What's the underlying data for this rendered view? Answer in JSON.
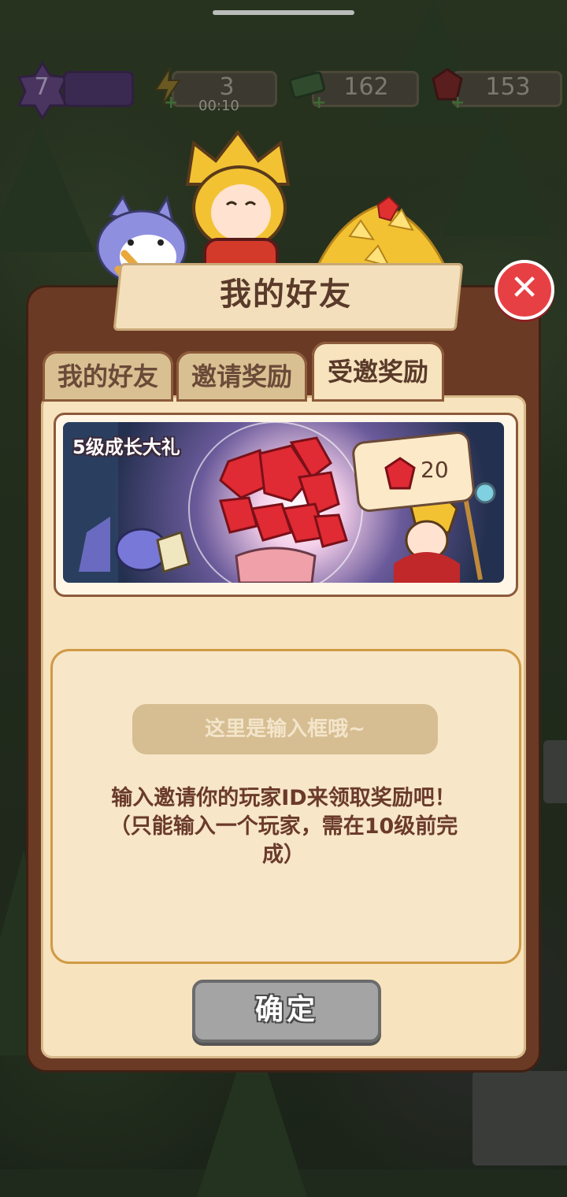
{
  "hud": {
    "level": "7",
    "energy": "3",
    "energy_timer": "00:10",
    "cash": "162",
    "gems": "153",
    "icons": [
      "star-badge-icon",
      "lightning-icon",
      "cash-icon",
      "gem-icon"
    ]
  },
  "panel": {
    "title": "我的好友",
    "close_icon": "close-icon"
  },
  "tabs": [
    {
      "label": "我的好友",
      "active": false
    },
    {
      "label": "邀请奖励",
      "active": false
    },
    {
      "label": "受邀奖励",
      "active": true
    }
  ],
  "reward": {
    "label": "5级成长大礼",
    "gem_count": "20",
    "icon": "gem-icon"
  },
  "invite": {
    "placeholder": "这里是输入框哦~",
    "hint_lines": [
      "输入邀请你的玩家ID来领取奖励吧！",
      "（只能输入一个玩家，需在10级前完",
      "成）"
    ]
  },
  "confirm_label": "确定",
  "colors": {
    "panel_brown": "#6b3a24",
    "panel_cream": "#f7e3bd",
    "close_red": "#e74044",
    "confirm_gray": "#a4a4a4",
    "hint_text": "#6a3a2a"
  }
}
